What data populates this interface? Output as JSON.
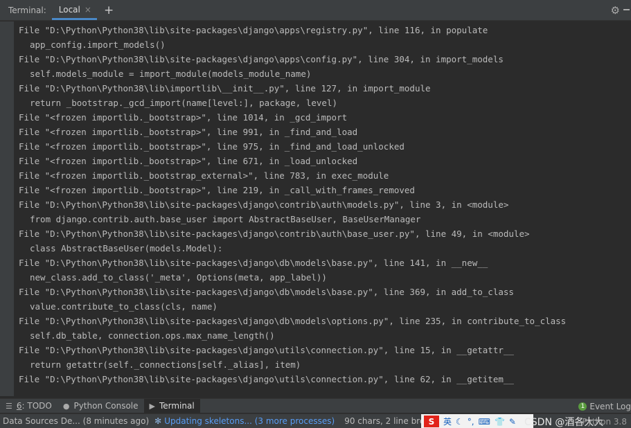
{
  "header": {
    "title": "Terminal:",
    "tab_label": "Local",
    "tab_close": "×",
    "new_tab": "+"
  },
  "terminal": {
    "lines": [
      "File \"D:\\Python\\Python38\\lib\\site-packages\\django\\apps\\registry.py\", line 116, in populate",
      "  app_config.import_models()",
      "File \"D:\\Python\\Python38\\lib\\site-packages\\django\\apps\\config.py\", line 304, in import_models",
      "  self.models_module = import_module(models_module_name)",
      "File \"D:\\Python\\Python38\\lib\\importlib\\__init__.py\", line 127, in import_module",
      "  return _bootstrap._gcd_import(name[level:], package, level)",
      "File \"<frozen importlib._bootstrap>\", line 1014, in _gcd_import",
      "File \"<frozen importlib._bootstrap>\", line 991, in _find_and_load",
      "File \"<frozen importlib._bootstrap>\", line 975, in _find_and_load_unlocked",
      "File \"<frozen importlib._bootstrap>\", line 671, in _load_unlocked",
      "File \"<frozen importlib._bootstrap_external>\", line 783, in exec_module",
      "File \"<frozen importlib._bootstrap>\", line 219, in _call_with_frames_removed",
      "File \"D:\\Python\\Python38\\lib\\site-packages\\django\\contrib\\auth\\models.py\", line 3, in <module>",
      "  from django.contrib.auth.base_user import AbstractBaseUser, BaseUserManager",
      "File \"D:\\Python\\Python38\\lib\\site-packages\\django\\contrib\\auth\\base_user.py\", line 49, in <module>",
      "  class AbstractBaseUser(models.Model):",
      "File \"D:\\Python\\Python38\\lib\\site-packages\\django\\db\\models\\base.py\", line 141, in __new__",
      "  new_class.add_to_class('_meta', Options(meta, app_label))",
      "File \"D:\\Python\\Python38\\lib\\site-packages\\django\\db\\models\\base.py\", line 369, in add_to_class",
      "  value.contribute_to_class(cls, name)",
      "File \"D:\\Python\\Python38\\lib\\site-packages\\django\\db\\models\\options.py\", line 235, in contribute_to_class",
      "  self.db_table, connection.ops.max_name_length()",
      "File \"D:\\Python\\Python38\\lib\\site-packages\\django\\utils\\connection.py\", line 15, in __getattr__",
      "  return getattr(self._connections[self._alias], item)",
      "File \"D:\\Python\\Python38\\lib\\site-packages\\django\\utils\\connection.py\", line 62, in __getitem__"
    ]
  },
  "toolwindows": {
    "todo_number": "6",
    "todo_label": ": TODO",
    "python_console": "Python Console",
    "terminal": "Terminal",
    "event_log": "Event Log",
    "event_count": "1"
  },
  "status": {
    "fragment": "Data Sources De...",
    "time_ago": "(8 minutes ago)",
    "progress": "Updating skeletons... (3 more processes)",
    "chars": "90 chars, 2 line brea",
    "ime_s": "S",
    "ime_lang": "英",
    "watermark": "CSDN @酒各大大",
    "python_version": "Python 3.8"
  }
}
